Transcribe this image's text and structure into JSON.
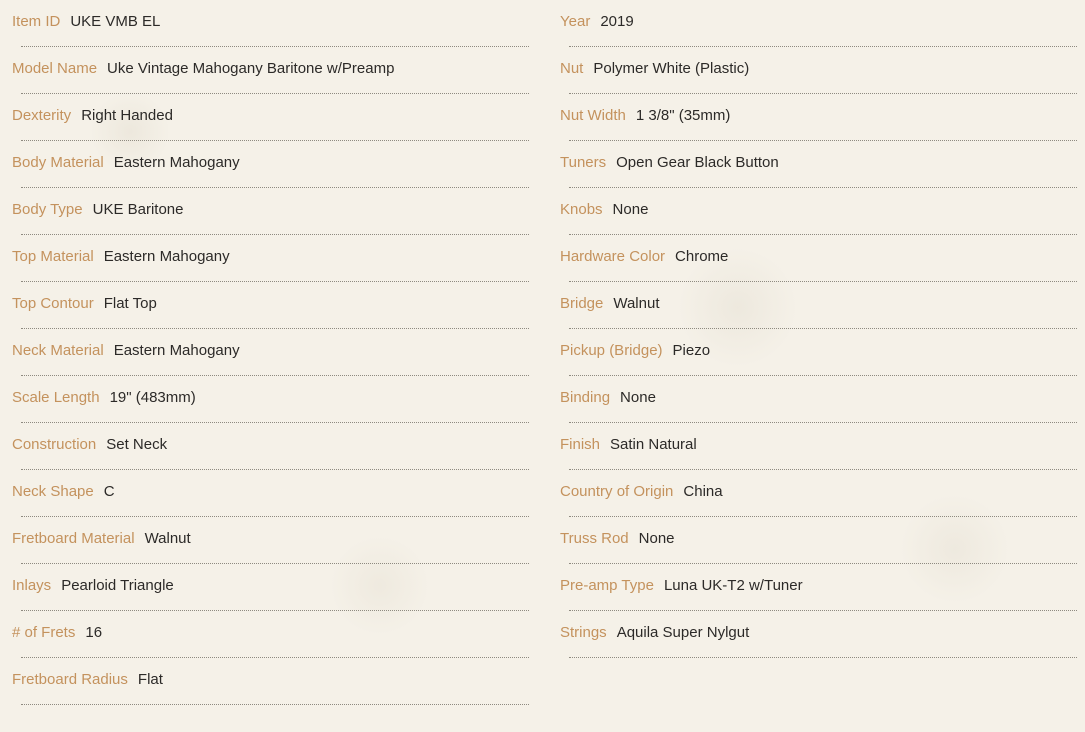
{
  "colors": {
    "background": "#f5f1e8",
    "label": "#c4925d",
    "value": "#2c2a28",
    "divider": "#8e8a80"
  },
  "specs": {
    "left": [
      {
        "label": "Item ID",
        "value": "UKE VMB EL"
      },
      {
        "label": "Model Name",
        "value": "Uke Vintage Mahogany Baritone w/Preamp"
      },
      {
        "label": "Dexterity",
        "value": "Right Handed"
      },
      {
        "label": "Body Material",
        "value": "Eastern Mahogany"
      },
      {
        "label": "Body Type",
        "value": "UKE Baritone"
      },
      {
        "label": "Top Material",
        "value": "Eastern Mahogany"
      },
      {
        "label": "Top Contour",
        "value": "Flat Top"
      },
      {
        "label": "Neck Material",
        "value": "Eastern Mahogany"
      },
      {
        "label": "Scale Length",
        "value": "19\" (483mm)"
      },
      {
        "label": "Construction",
        "value": "Set Neck"
      },
      {
        "label": "Neck Shape",
        "value": "C"
      },
      {
        "label": "Fretboard Material",
        "value": "Walnut"
      },
      {
        "label": "Inlays",
        "value": "Pearloid Triangle"
      },
      {
        "label": "# of Frets",
        "value": "16"
      },
      {
        "label": "Fretboard Radius",
        "value": "Flat"
      }
    ],
    "right": [
      {
        "label": "Year",
        "value": "2019"
      },
      {
        "label": "Nut",
        "value": "Polymer White (Plastic)"
      },
      {
        "label": "Nut Width",
        "value": "1 3/8\" (35mm)"
      },
      {
        "label": "Tuners",
        "value": "Open Gear Black Button"
      },
      {
        "label": "Knobs",
        "value": "None"
      },
      {
        "label": "Hardware Color",
        "value": "Chrome"
      },
      {
        "label": "Bridge",
        "value": "Walnut"
      },
      {
        "label": "Pickup (Bridge)",
        "value": "Piezo"
      },
      {
        "label": "Binding",
        "value": "None"
      },
      {
        "label": "Finish",
        "value": "Satin Natural"
      },
      {
        "label": "Country of Origin",
        "value": "China"
      },
      {
        "label": "Truss Rod",
        "value": "None"
      },
      {
        "label": "Pre-amp Type",
        "value": "Luna UK-T2 w/Tuner"
      },
      {
        "label": "Strings",
        "value": "Aquila Super Nylgut"
      }
    ]
  }
}
